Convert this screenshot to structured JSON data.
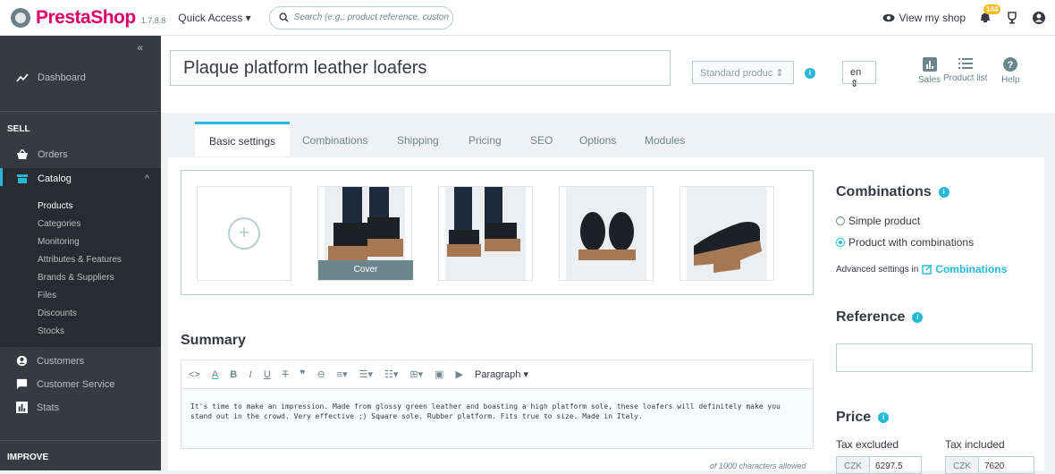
{
  "header": {
    "brand": "PrestaShop",
    "version": "1.7.8.8",
    "quick_access": "Quick Access",
    "search_placeholder": "Search (e.g.: product reference, custon",
    "view_shop": "View my shop",
    "notif_count": "144"
  },
  "sidebar": {
    "collapse": "«",
    "dashboard": "Dashboard",
    "sell": "SELL",
    "orders": "Orders",
    "catalog": "Catalog",
    "catalog_sub": [
      "Products",
      "Categories",
      "Monitoring",
      "Attributes & Features",
      "Brands & Suppliers",
      "Files",
      "Discounts",
      "Stocks"
    ],
    "customers": "Customers",
    "customer_service": "Customer Service",
    "stats": "Stats",
    "improve": "IMPROVE"
  },
  "product": {
    "name": "Plaque platform leather loafers",
    "type": "Standard produc",
    "lang": "en",
    "tools": [
      "Sales",
      "Product list",
      "Help"
    ]
  },
  "tabs": [
    "Basic settings",
    "Combinations",
    "Shipping",
    "Pricing",
    "SEO",
    "Options",
    "Modules"
  ],
  "images": {
    "cover_label": "Cover"
  },
  "summary": {
    "title": "Summary",
    "format": "Paragraph",
    "text": "It's time to make an impression. Made from glossy green leather and boasting a high platform sole, these loafers will definitely make you stand out in the crowd. Very effective ;) Square sole. Rubber platform. Fits true to size. Made in Italy.",
    "char_limit": "of 1000 characters allowed"
  },
  "combinations": {
    "title": "Combinations",
    "simple": "Simple product",
    "with": "Product with combinations",
    "selected": "with",
    "advanced": "Advanced settings in",
    "advanced_link": "Combinations"
  },
  "reference": {
    "title": "Reference",
    "value": ""
  },
  "price": {
    "title": "Price",
    "tax_excluded": "Tax excluded",
    "tax_included": "Tax included",
    "currency": "CZK",
    "excl_value": "6297.5",
    "incl_value": "7620"
  },
  "colors": {
    "accent": "#25b9d7",
    "brand": "#df0067",
    "sidebar": "#363a41"
  }
}
